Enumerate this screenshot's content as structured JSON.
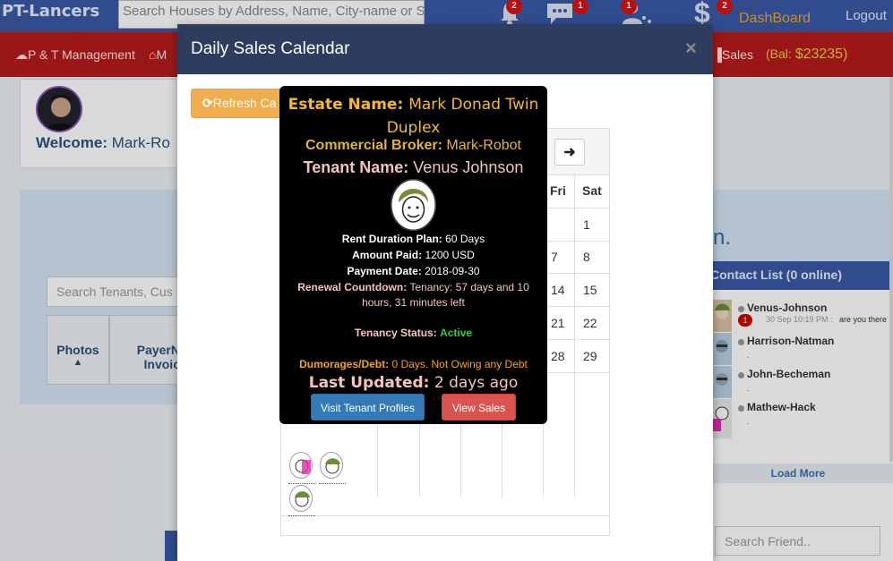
{
  "topbar": {
    "brand": "PT-Lancers",
    "search_placeholder": "Search Houses by Address, Name, City-name or S",
    "notifications_count": "2",
    "messages_count": "1",
    "users_count": "1",
    "money_count": "2",
    "dashboard_label": "DashBoard",
    "logout_label": "Logout"
  },
  "navbar": {
    "item1_label": "P & T Management",
    "item2_label": "M",
    "sales_label": "Sales",
    "balance_prefix": "(Bal:",
    "balance_value": "$23235)"
  },
  "welcome": {
    "prefix": "Welcome:",
    "name": "Mark-Ro"
  },
  "tenants": {
    "search_placeholder": "Search Tenants, Cus",
    "col_photos": "Photos",
    "col_payer_line1": "PayerN",
    "col_payer_line2": "Invoic"
  },
  "right_fragment": "n.",
  "contacts": {
    "title": "Contact List (0 online)",
    "items": [
      {
        "name": "Venus-Johnson",
        "badge": "1",
        "time": "30 Sep 10:19 PM :",
        "message": "are you there"
      },
      {
        "name": "Harrison-Natman",
        "sub": "."
      },
      {
        "name": "John-Becheman",
        "sub": "."
      },
      {
        "name": "Mathew-Hack",
        "sub": "."
      }
    ],
    "load_more": "Load More",
    "search_placeholder": "Search Friend.."
  },
  "modal": {
    "title": "Daily Sales Calendar",
    "close": "×",
    "refresh_label": "Refresh Ca",
    "next_arrow": "➜"
  },
  "calendar": {
    "day_headers": [
      "Fri",
      "Sat"
    ],
    "dates": [
      {
        "fri": "",
        "sat": "1"
      },
      {
        "fri": "7",
        "sat": "8"
      },
      {
        "fri": "14",
        "sat": "15"
      },
      {
        "fri": "21",
        "sat": "22"
      },
      {
        "fri": "28",
        "sat": "29"
      }
    ]
  },
  "tooltip": {
    "estate_label": "Estate Name:",
    "estate_value": "Mark Donad Twin Duplex",
    "broker_label": "Commercial Broker:",
    "broker_value": "Mark-Robot",
    "tenant_label": "Tenant Name:",
    "tenant_value": "Venus Johnson",
    "rent_label": "Rent Duration Plan:",
    "rent_value": "60 Days",
    "amount_label": "Amount Paid:",
    "amount_value": "1200 USD",
    "payment_label": "Payment Date:",
    "payment_value": "2018-09-30",
    "renewal_label": "Renewal Countdown:",
    "renewal_value": "Tenancy: 57 days and 10 hours, 31 minutes left",
    "status_label": "Tenancy Status:",
    "status_value": "Active",
    "dumorage_label": "Dumorages/Debt:",
    "dumorage_value": "0 Days. Not Owing any Debt",
    "updated_label": "Last Updated:",
    "updated_value": "2 days ago",
    "visit_label": "Visit Tenant Profiles",
    "sales_label": "View Sales"
  }
}
